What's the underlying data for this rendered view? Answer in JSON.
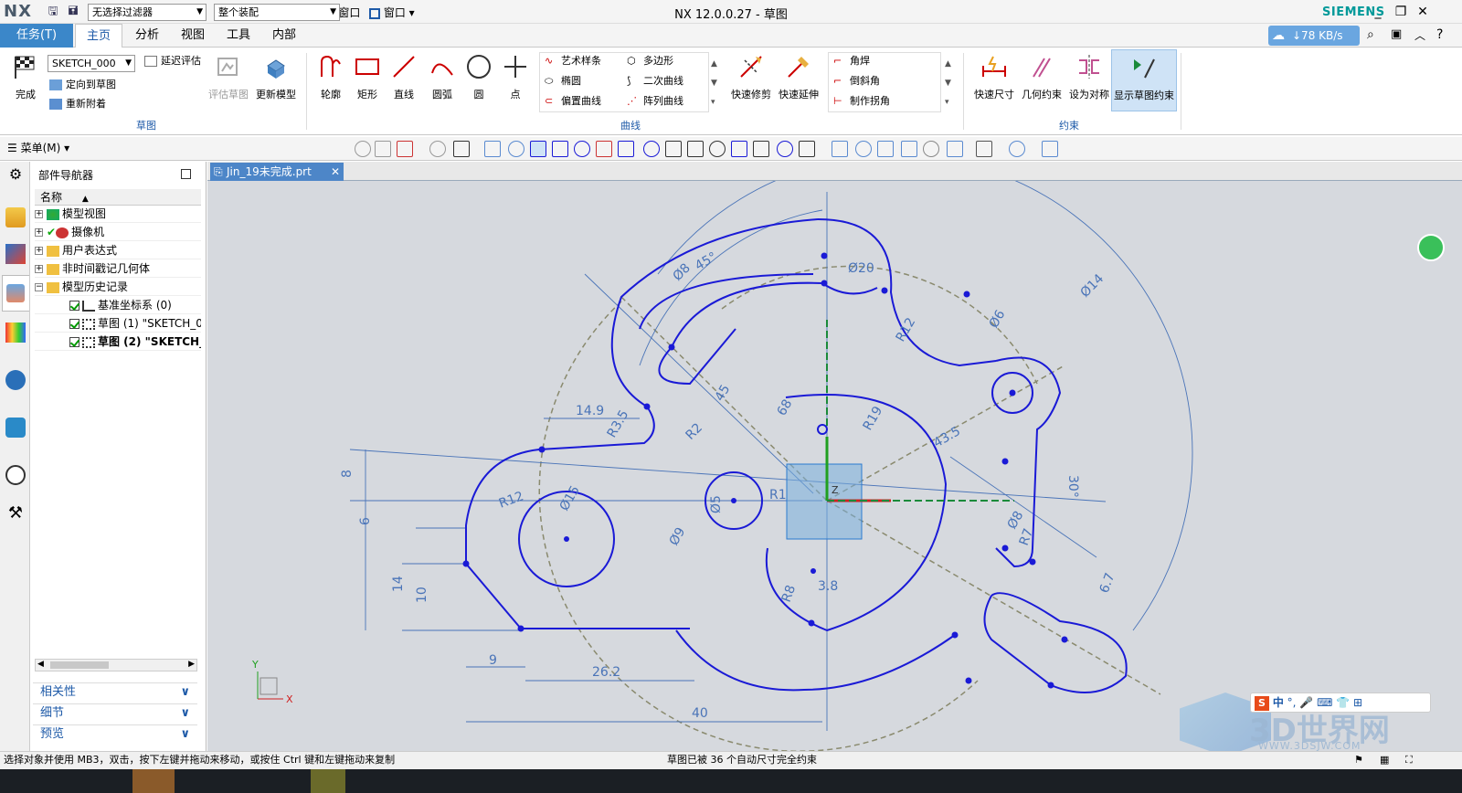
{
  "title_bar": {
    "logo": "NX",
    "title": "NX 12.0.0.27 - 草图",
    "brand": "SIEMENS",
    "window_buttons": [
      "_",
      "❐",
      "✕"
    ],
    "quick_access": [
      "save",
      "save-all",
      "undo",
      "redo",
      "cut",
      "copy",
      "paste",
      "print",
      "repeat"
    ],
    "switch_window_label": "切换窗口",
    "window_menu_label": "窗口"
  },
  "tabs": [
    "任务(T)",
    "主页",
    "分析",
    "视图",
    "工具",
    "内部"
  ],
  "net_speed": "↓78 KB/s",
  "ribbon": {
    "sketch_group": {
      "label": "草图",
      "finish": "完成",
      "sketch_name": "SKETCH_000",
      "delay_eval": "延迟评估",
      "orient": "定向到草图",
      "reattach": "重新附着",
      "eval_sketch": "评估草图",
      "update_model": "更新模型"
    },
    "curve_tools": [
      "轮廓",
      "矩形",
      "直线",
      "圆弧",
      "圆",
      "点"
    ],
    "curve_group": {
      "label": "曲线",
      "small": [
        "艺术样条",
        "多边形",
        "椭圆",
        "二次曲线",
        "偏置曲线",
        "阵列曲线"
      ],
      "quick_trim": "快速修剪",
      "quick_extend": "快速延伸",
      "corner": [
        "角焊",
        "倒斜角",
        "制作拐角"
      ]
    },
    "constraint_group": {
      "label": "约束",
      "items": [
        "快速尺寸",
        "几何约束",
        "设为对称",
        "显示草图约束"
      ]
    }
  },
  "command_bar": {
    "menu": "菜单(M)",
    "filter": "无选择过滤器",
    "scope": "整个装配"
  },
  "navigator": {
    "title": "部件导航器",
    "column": "名称",
    "rows": [
      "模型视图",
      "摄像机",
      "用户表达式",
      "非时间戳记几何体",
      "模型历史记录",
      "基准坐标系 (0)",
      "草图 (1) \"SKETCH_0",
      "草图 (2) \"SKETCH_"
    ],
    "panels": [
      "相关性",
      "细节",
      "预览"
    ]
  },
  "document_tab": "Jin_19未完成.prt",
  "drawing": {
    "dims": [
      "14.9",
      "8",
      "6",
      "14",
      "10",
      "9",
      "26.2",
      "40",
      "R12",
      "Ø15",
      "Ø9",
      "Ø5",
      "R1",
      "R19",
      "R2",
      "R3.5",
      "Ø8",
      "45°",
      "Ø20",
      "R12",
      "Ø14",
      "Ø6",
      "43.5",
      "30°",
      "R7",
      "Ø8",
      "6.7",
      "3.8",
      "R8",
      "45",
      "68"
    ],
    "axis_x": "X",
    "axis_y": "Y",
    "axis_z": "Z"
  },
  "status": {
    "left": "选择对象并使用 MB3，双击，按下左键并拖动来移动，或按住 Ctrl 键和左键拖动来复制",
    "center": "草图已被 36 个自动尺寸完全约束"
  },
  "watermark": {
    "brand": "3D世界网",
    "url": "WWW.3DSJW.COM"
  },
  "ime": {
    "label": "中"
  },
  "colors": {
    "accent": "#3b87c9",
    "sketch": "#1a1ad6",
    "dim": "#4a74b8",
    "canvas": "#d6d9de"
  }
}
